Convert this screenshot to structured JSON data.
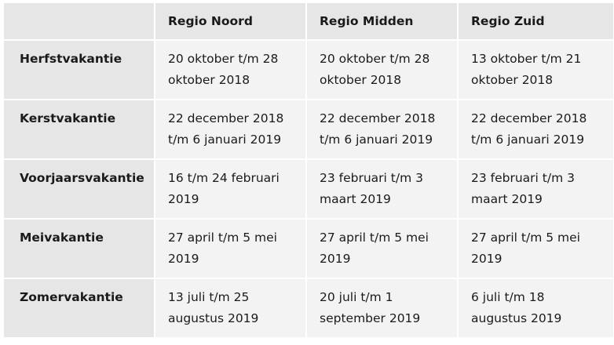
{
  "headers": [
    "",
    "Regio Noord",
    "Regio Midden",
    "Regio Zuid"
  ],
  "rows": [
    {
      "name": "Herfstvakantie",
      "noord": "20 oktober t/m 28 oktober 2018",
      "midden": "20 oktober t/m 28 oktober 2018",
      "zuid": "13 oktober t/m 21 oktober 2018"
    },
    {
      "name": "Kerstvakantie",
      "noord": "22 december 2018 t/m 6 januari 2019",
      "midden": "22 december 2018 t/m 6 januari 2019",
      "zuid": "22 december 2018 t/m 6 januari 2019"
    },
    {
      "name": "Voorjaarsvakantie",
      "noord": "16 t/m 24 februari 2019",
      "midden": "23 februari t/m 3 maart 2019",
      "zuid": "23 februari t/m 3 maart 2019"
    },
    {
      "name": "Meivakantie",
      "noord": "27 april t/m 5 mei 2019",
      "midden": "27 april t/m 5 mei 2019",
      "zuid": "27 april t/m 5 mei 2019"
    },
    {
      "name": "Zomervakantie",
      "noord": "13 juli t/m 25 augustus 2019",
      "midden": "20 juli t/m 1 september 2019",
      "zuid": "6 juli t/m 18 augustus 2019"
    }
  ]
}
